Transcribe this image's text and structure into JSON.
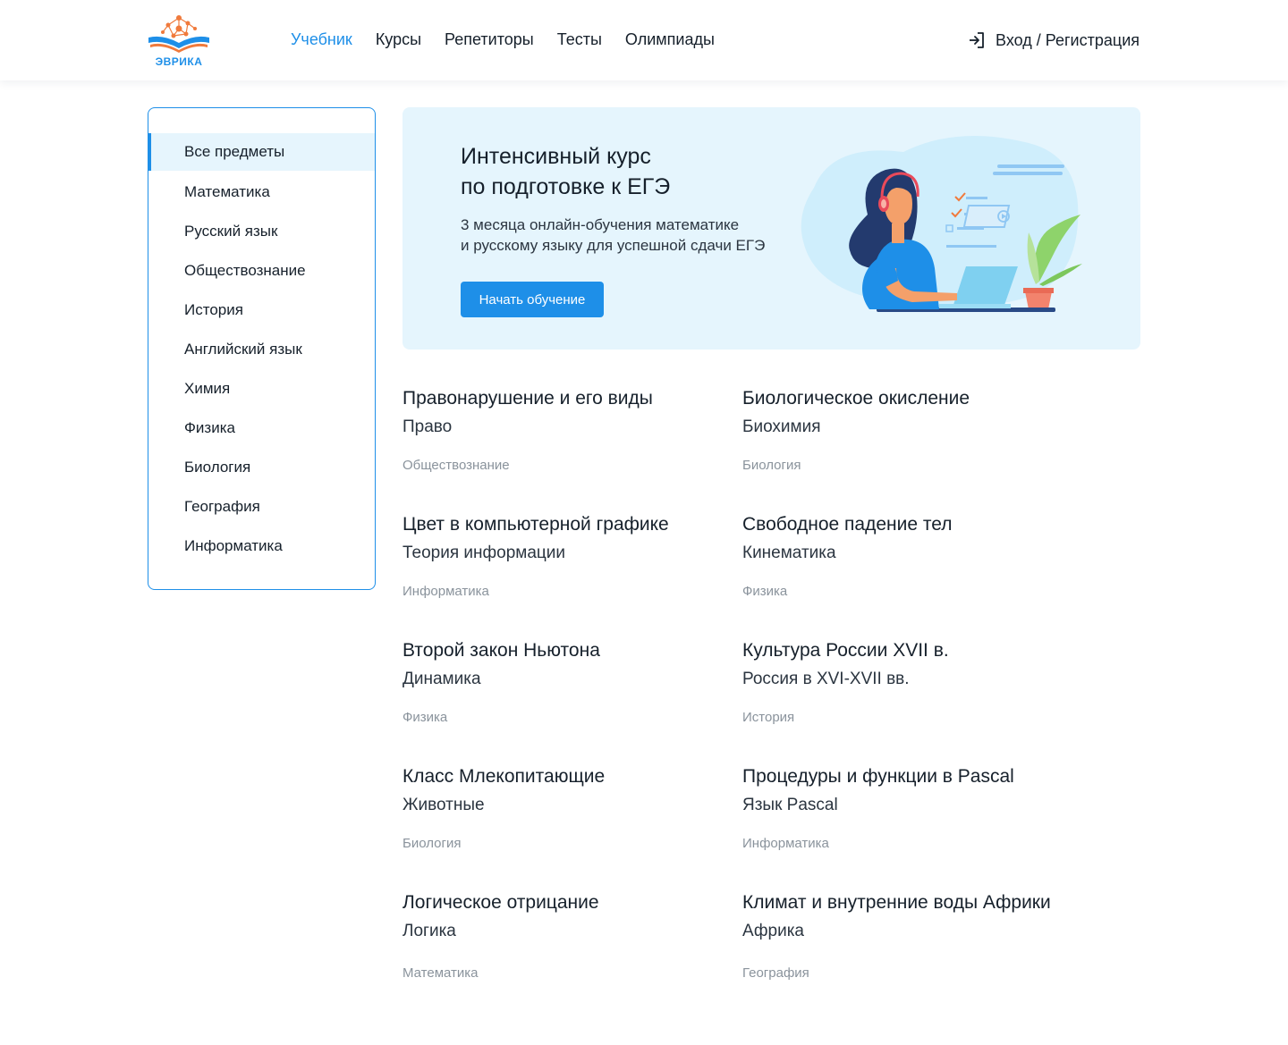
{
  "header": {
    "logo_text": "ЭВРИКА",
    "nav": [
      {
        "label": "Учебник",
        "active": true
      },
      {
        "label": "Курсы"
      },
      {
        "label": "Репетиторы"
      },
      {
        "label": "Тесты"
      },
      {
        "label": "Олимпиады"
      }
    ],
    "login_label": "Вход / Регистрация",
    "login_icon": "login-icon"
  },
  "sidebar": {
    "items": [
      {
        "label": "Все предметы",
        "active": true
      },
      {
        "label": "Математика"
      },
      {
        "label": "Русский язык"
      },
      {
        "label": "Обществознание"
      },
      {
        "label": "История"
      },
      {
        "label": "Английский язык"
      },
      {
        "label": "Химия"
      },
      {
        "label": "Физика"
      },
      {
        "label": "Биология"
      },
      {
        "label": "География"
      },
      {
        "label": "Информатика"
      }
    ]
  },
  "banner": {
    "title_line1": "Интенсивный курс",
    "title_line2": "по подготовке к ЕГЭ",
    "subtitle_line1": "3 месяца онлайн-обучения математике",
    "subtitle_line2": "и русскому языку для успешной сдачи ЕГЭ",
    "button_label": "Начать обучение"
  },
  "cards": [
    {
      "title": "Правонарушение и его виды",
      "topic": "Право",
      "subject": "Обществознание"
    },
    {
      "title": "Биологическое окисление",
      "topic": "Биохимия",
      "subject": "Биология"
    },
    {
      "title": "Цвет в компьютерной графике",
      "topic": "Теория информации",
      "subject": "Информатика"
    },
    {
      "title": "Свободное падение тел",
      "topic": "Кинематика",
      "subject": "Физика"
    },
    {
      "title": "Второй закон Ньютона",
      "topic": "Динамика",
      "subject": "Физика"
    },
    {
      "title": "Культура России XVII в.",
      "topic": "Россия в XVI-XVII вв.",
      "subject": "История"
    },
    {
      "title": "Класс Млекопитающие",
      "topic": "Животные",
      "subject": "Биология"
    },
    {
      "title": "Процедуры и функции в Pascal",
      "topic": "Язык Pascal",
      "subject": "Информатика"
    },
    {
      "title": "Логическое отрицание",
      "topic": "Логика",
      "subject": "Математика"
    },
    {
      "title": "Климат и внутренние воды Африки",
      "topic": "Африка",
      "subject": "География"
    }
  ],
  "colors": {
    "accent": "#1e8fe8",
    "banner_bg": "#e5f5fd",
    "sidebar_active_bg": "#e6f5fd",
    "logo_orange": "#f07a3c",
    "muted_text": "#8a939c"
  }
}
